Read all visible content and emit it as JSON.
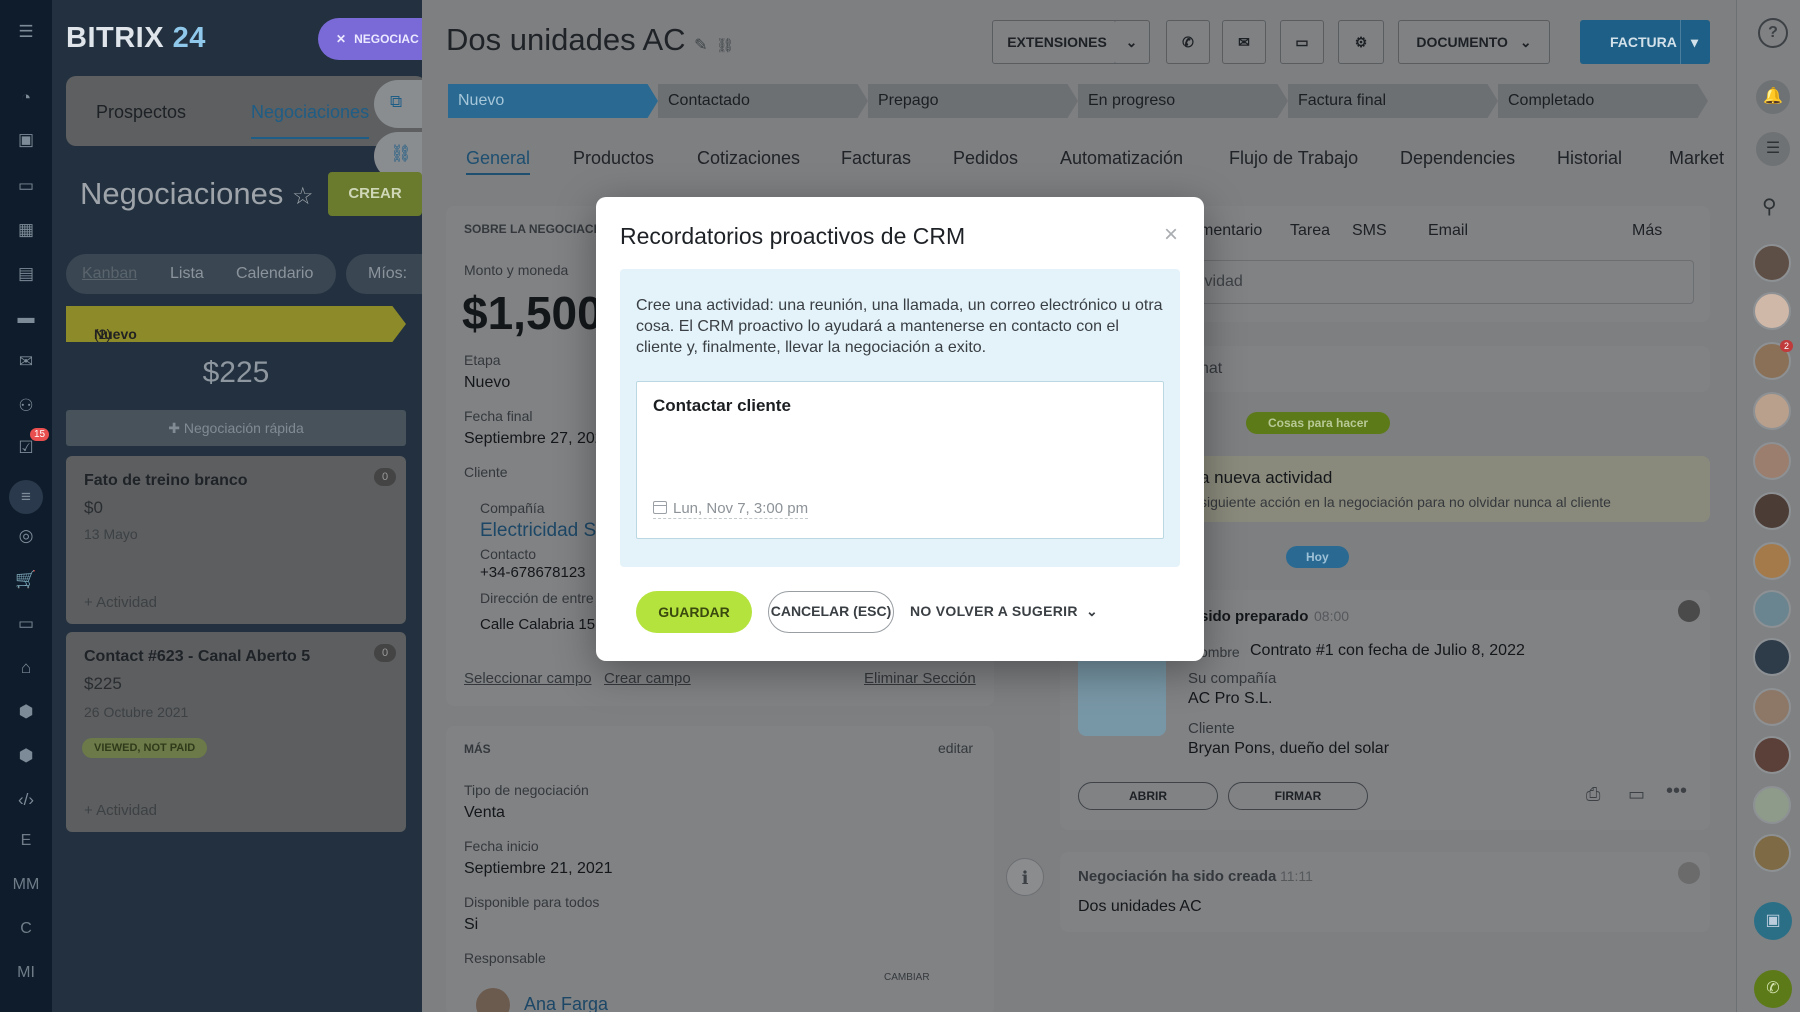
{
  "app": {
    "logo_main": "BITRIX",
    "logo_num": "24",
    "chip_label": "NEGOCIAC"
  },
  "left_rail": {
    "badge": "15",
    "text_items": [
      "E",
      "MM",
      "C",
      "MI"
    ]
  },
  "bg_crm": {
    "tabs": [
      "Prospectos",
      "Negociaciones"
    ],
    "title": "Negociaciones",
    "create_label": "CREAR",
    "views": [
      "Kanban",
      "Lista",
      "Calendario"
    ],
    "mios": "Míos:",
    "stage": "Nuevo",
    "stage_count": "(2)",
    "total": "$225",
    "quick": "Negociación rápida",
    "cards": [
      {
        "title": "Fato de treino branco",
        "value": "$0",
        "date": "13 Mayo",
        "count": "0",
        "add": "+ Actividad"
      },
      {
        "title": "Contact #623 - Canal Aberto 5",
        "value": "$225",
        "date": "26 Octubre 2021",
        "count": "0",
        "status": "VIEWED, NOT PAID",
        "add": "+ Actividad"
      }
    ]
  },
  "deal": {
    "title": "Dos unidades AC",
    "toolbar": {
      "extensions": "EXTENSIONES",
      "document": "DOCUMENTO",
      "invoice": "FACTURA"
    },
    "stages": [
      "Nuevo",
      "Contactado",
      "Prepago",
      "En progreso",
      "Factura final",
      "Completado"
    ],
    "tabs": [
      "General",
      "Productos",
      "Cotizaciones",
      "Facturas",
      "Pedidos",
      "Automatización",
      "Flujo de Trabajo",
      "Dependencies",
      "Historial",
      "Market"
    ],
    "about": {
      "section": "SOBRE LA NEGOCIACIÓ",
      "amount_label": "Monto y moneda",
      "amount": "$1,500",
      "stage_label": "Etapa",
      "stage": "Nuevo",
      "end_label": "Fecha final",
      "end": "Septiembre 27, 2021",
      "client_label": "Cliente",
      "company_label": "Compañía",
      "company": "Electricidad S",
      "contact_label": "Contacto",
      "phone": "+34-678678123",
      "address_label": "Dirección de entre",
      "address": "Calle Calabria 151",
      "select_field": "Seleccionar campo",
      "create_field": "Crear campo",
      "delete_section": "Eliminar Sección"
    },
    "more": {
      "section": "MÁS",
      "edit": "editar",
      "type_label": "Tipo de negociación",
      "type": "Venta",
      "start_label": "Fecha inicio",
      "start": "Septiembre 21, 2021",
      "avail_label": "Disponible para todos",
      "avail": "Si",
      "resp_label": "Responsable",
      "change": "CAMBIAR",
      "resp": "Ana Farga"
    },
    "timeline": {
      "tabs": [
        "mentario",
        "Tarea",
        "SMS",
        "Email",
        "Más"
      ],
      "activity_placeholder": "ividad",
      "chat": "hat",
      "todo": "Cosas para hacer",
      "new_activity": "a nueva actividad",
      "new_activity_sub": "siguiente acción en la negociación para no olvidar nunca al cliente",
      "today": "Hoy",
      "doc_title": "sido preparado",
      "doc_time": "08:00",
      "name_label": "ombre",
      "name": "Contrato #1 con fecha de Julio 8, 2022",
      "company_label": "Su compañía",
      "company": "AC Pro S.L.",
      "client_label": "Cliente",
      "client": "Bryan Pons, dueño del solar",
      "open": "ABRIR",
      "sign": "FIRMAR",
      "created": "Negociación ha sido creada",
      "created_time": "11:11",
      "created_text": "Dos unidades AC"
    }
  },
  "right_rail": {
    "notif_badge": "2"
  },
  "modal": {
    "title": "Recordatorios proactivos de CRM",
    "info": "Cree una actividad: una reunión, una llamada, un correo electrónico u otra cosa. El CRM proactivo lo ayudará a mantenerse en contacto con el cliente y, finalmente, llevar la negociación a exito.",
    "task": "Contactar cliente",
    "date": "Lun, Nov 7, 3:00 pm",
    "save": "GUARDAR",
    "cancel": "CANCELAR (ESC)",
    "no_suggest": "NO VOLVER A SUGERIR"
  },
  "colors": {
    "accent": "#2fc6f6",
    "save": "#bbed21",
    "overlay": "#7d7f81"
  }
}
